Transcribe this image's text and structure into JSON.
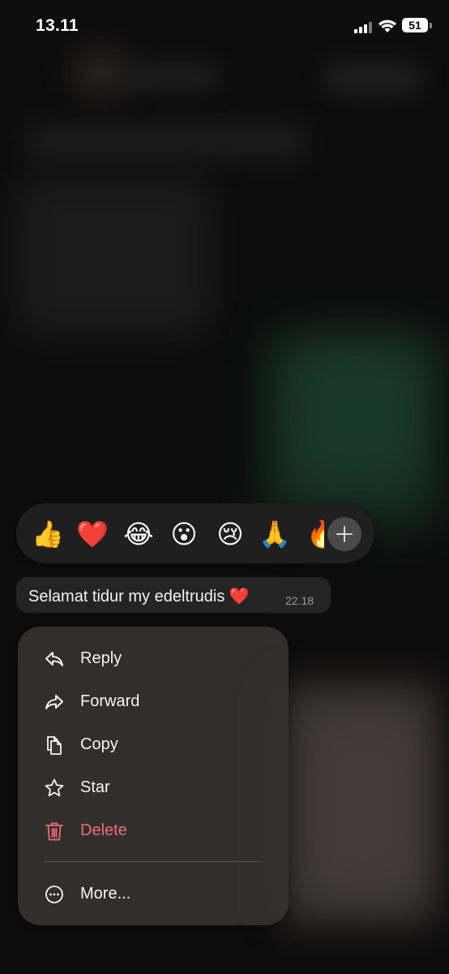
{
  "status_bar": {
    "time": "13.11",
    "battery": "51",
    "icons": [
      "cellular-signal-icon",
      "wifi-icon",
      "battery-icon"
    ]
  },
  "reactions": {
    "items": [
      {
        "name": "thumbs-up-icon",
        "glyph": "👍"
      },
      {
        "name": "red-heart-icon",
        "glyph": "❤️"
      },
      {
        "name": "tears-of-joy-icon",
        "glyph": "😂"
      },
      {
        "name": "surprised-face-icon",
        "glyph": "😮"
      },
      {
        "name": "crying-face-icon",
        "glyph": "😢"
      },
      {
        "name": "folded-hands-icon",
        "glyph": "🙏"
      },
      {
        "name": "fire-icon",
        "glyph": "🔥"
      }
    ],
    "more_icon": "plus-icon"
  },
  "message": {
    "text": "Selamat tidur my edeltrudis ❤️",
    "time": "22.18"
  },
  "menu": {
    "items": [
      {
        "label": "Reply",
        "icon": "reply-icon"
      },
      {
        "label": "Forward",
        "icon": "forward-icon"
      },
      {
        "label": "Copy",
        "icon": "copy-icon"
      },
      {
        "label": "Star",
        "icon": "star-icon"
      },
      {
        "label": "Delete",
        "icon": "trash-icon",
        "color": "#ec6d72"
      },
      {
        "label": "More...",
        "icon": "more-icon"
      }
    ]
  },
  "colors": {
    "menu_bg": "#343231",
    "danger": "#ec6d72",
    "bubble_bg": "#242424"
  }
}
